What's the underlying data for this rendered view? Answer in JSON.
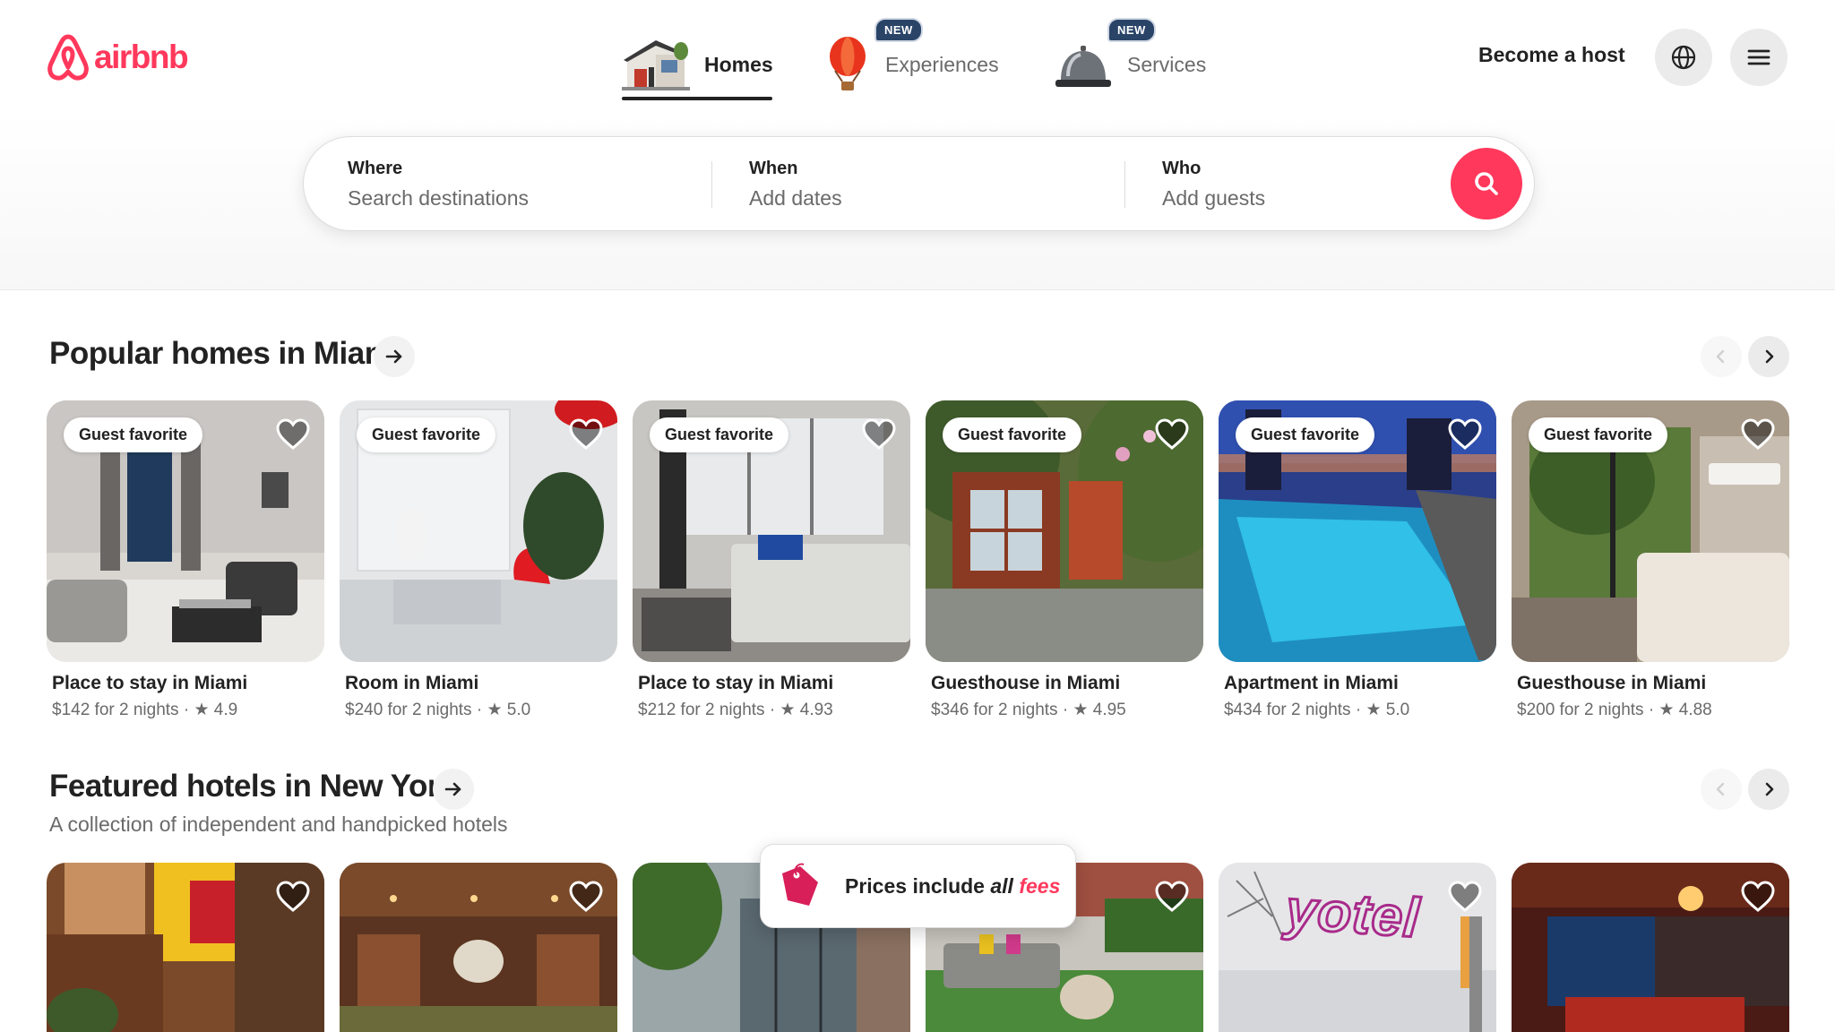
{
  "brand": {
    "name": "airbnb",
    "color": "#ff385c"
  },
  "nav": {
    "tabs": [
      {
        "label": "Homes",
        "active": true,
        "icon": "house-icon"
      },
      {
        "label": "Experiences",
        "badge": "NEW",
        "icon": "hot-air-balloon-icon"
      },
      {
        "label": "Services",
        "badge": "NEW",
        "icon": "service-bell-icon"
      }
    ],
    "become_host": "Become a host"
  },
  "search": {
    "where": {
      "title": "Where",
      "placeholder": "Search destinations"
    },
    "when": {
      "title": "When",
      "placeholder": "Add dates"
    },
    "who": {
      "title": "Who",
      "placeholder": "Add guests"
    }
  },
  "popular": {
    "title": "Popular homes in Miami",
    "cards": [
      {
        "badge": "Guest favorite",
        "title": "Place to stay in Miami",
        "price": "$142 for 2 nights",
        "rating": "4.9"
      },
      {
        "badge": "Guest favorite",
        "title": "Room in Miami",
        "price": "$240 for 2 nights",
        "rating": "5.0"
      },
      {
        "badge": "Guest favorite",
        "title": "Place to stay in Miami",
        "price": "$212 for 2 nights",
        "rating": "4.93"
      },
      {
        "badge": "Guest favorite",
        "title": "Guesthouse in Miami",
        "price": "$346 for 2 nights",
        "rating": "4.95"
      },
      {
        "badge": "Guest favorite",
        "title": "Apartment in Miami",
        "price": "$434 for 2 nights",
        "rating": "5.0"
      },
      {
        "badge": "Guest favorite",
        "title": "Guesthouse in Miami",
        "price": "$200 for 2 nights",
        "rating": "4.88"
      }
    ]
  },
  "hotels": {
    "title": "Featured hotels in New York",
    "subtitle": "A collection of independent and handpicked hotels",
    "sign_text": "yotel"
  },
  "fees_popup": {
    "text_main": "Prices include ",
    "text_all": "all ",
    "text_fees": "fees"
  },
  "separator": " · ",
  "star": "★"
}
